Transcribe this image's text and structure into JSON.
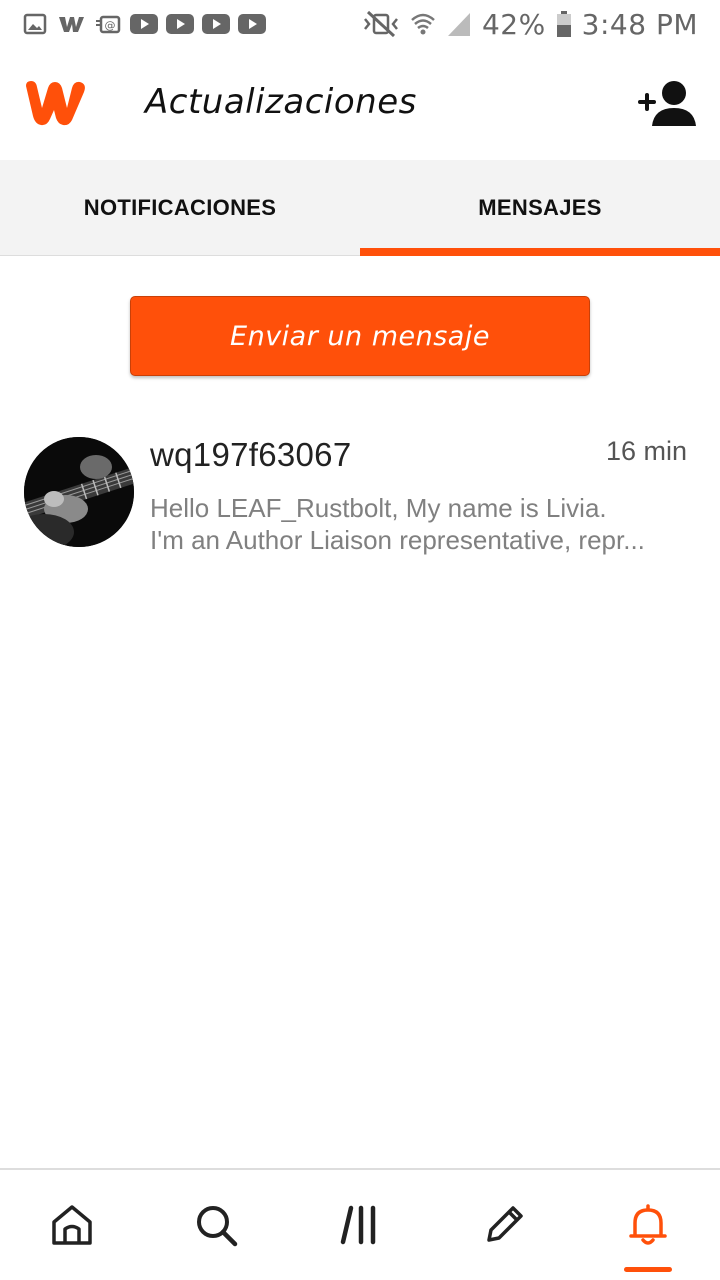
{
  "status_bar": {
    "battery": "42%",
    "time": "3:48 PM",
    "icons_left": [
      "image-icon",
      "wattpad-w-icon",
      "cast-email-icon",
      "youtube-icon",
      "youtube-icon",
      "youtube-icon",
      "youtube-icon"
    ],
    "icons_right": [
      "vibrate-mute-icon",
      "wifi-icon",
      "signal-icon",
      "battery-icon"
    ]
  },
  "app_bar": {
    "title": "Actualizaciones",
    "brand_color": "#ff500a"
  },
  "tabs": [
    {
      "label": "NOTIFICACIONES",
      "active": false
    },
    {
      "label": "MENSAJES",
      "active": true
    }
  ],
  "send_button": {
    "label": "Enviar un mensaje"
  },
  "messages": [
    {
      "username": "wq197f63067",
      "time": "16 min",
      "preview_line1": "Hello LEAF_Rustbolt,  My name is Livia.",
      "preview_line2": "I'm an Author Liaison representative, repr..."
    }
  ],
  "bottom_nav": {
    "items": [
      "home-icon",
      "search-icon",
      "library-icon",
      "write-icon",
      "notifications-icon"
    ],
    "active": "notifications-icon"
  }
}
